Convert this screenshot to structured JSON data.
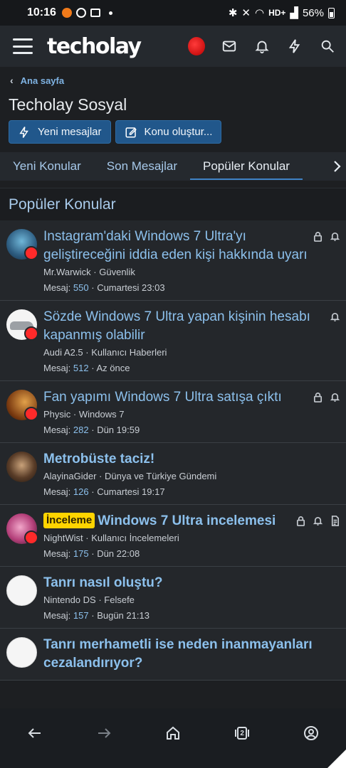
{
  "status_bar": {
    "time": "10:16",
    "network": "HD+",
    "battery": "56%"
  },
  "appbar": {
    "logo": "techolay"
  },
  "breadcrumb": {
    "label": "Ana sayfa"
  },
  "page": {
    "title": "Techolay Sosyal"
  },
  "actions": {
    "new_messages": "Yeni mesajlar",
    "new_thread": "Konu oluştur..."
  },
  "tabs": [
    "Yeni Konular",
    "Son Mesajlar",
    "Popüler Konular"
  ],
  "section": {
    "title": "Popüler Konular"
  },
  "threads": [
    {
      "title": "Instagram'daki Windows 7 Ultra'yı geliştireceğini iddia eden kişi hakkında uyarı",
      "author": "Mr.Warwick",
      "forum": "Güvenlik",
      "stats_label": "Mesaj:",
      "replies": "550",
      "time": "Cumartesi 23:03",
      "bold": false,
      "prefix": ""
    },
    {
      "title": "Sözde Windows 7 Ultra yapan kişinin hesabı kapanmış olabilir",
      "author": "Audi A2.5",
      "forum": "Kullanıcı Haberleri",
      "stats_label": "Mesaj:",
      "replies": "512",
      "time": "Az önce",
      "bold": false,
      "prefix": ""
    },
    {
      "title": "Fan yapımı Windows 7 Ultra satışa çıktı",
      "author": "Physic",
      "forum": "Windows 7",
      "stats_label": "Mesaj:",
      "replies": "282",
      "time": "Dün 19:59",
      "bold": false,
      "prefix": ""
    },
    {
      "title": "Metrobüste taciz!",
      "author": "AlayinaGider",
      "forum": "Dünya ve Türkiye Gündemi",
      "stats_label": "Mesaj:",
      "replies": "126",
      "time": "Cumartesi 19:17",
      "bold": true,
      "prefix": ""
    },
    {
      "title": "Windows 7 Ultra incelemesi",
      "author": "NightWist",
      "forum": "Kullanıcı İncelemeleri",
      "stats_label": "Mesaj:",
      "replies": "175",
      "time": "Dün 22:08",
      "bold": true,
      "prefix": "İnceleme"
    },
    {
      "title": "Tanrı nasıl oluştu?",
      "author": "Nintendo DS",
      "forum": "Felsefe",
      "stats_label": "Mesaj:",
      "replies": "157",
      "time": "Bugün 21:13",
      "bold": true,
      "prefix": ""
    },
    {
      "title": "Tanrı merhametli ise neden inanmayanları cezalandırıyor?",
      "author": "",
      "forum": "",
      "stats_label": "",
      "replies": "",
      "time": "",
      "bold": true,
      "prefix": ""
    }
  ],
  "colors": {
    "accent": "#3f83c6",
    "link": "#8cc0ec",
    "prefix_bg": "#ffd400",
    "badge": "#ff2a2a"
  },
  "bottom_nav": {
    "tab_count": "2"
  }
}
